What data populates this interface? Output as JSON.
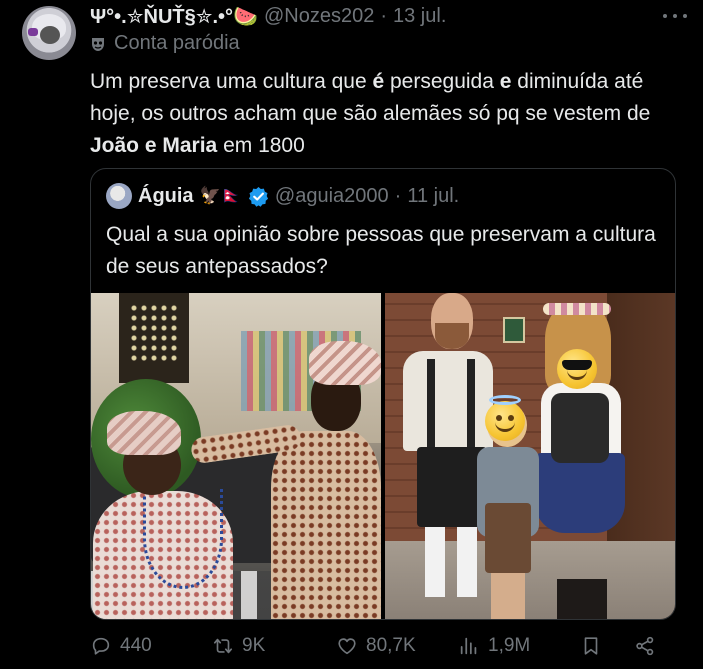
{
  "tweet": {
    "display_name": "Ψ°•.✮ŇUŤ§✮.•°🍉",
    "handle": "@Nozes202",
    "separator": "·",
    "date": "13 jul.",
    "parody_label": "Conta paródia",
    "text": {
      "p1": "Um preserva uma cultura que ",
      "b1": "é",
      "p2": " perseguida ",
      "b2": "e",
      "p3": " diminuída até hoje, os outros acham que são alemães só pq se vestem de ",
      "b3": "João e Maria",
      "p4": " em 1800"
    }
  },
  "quote": {
    "display_name": "Águia",
    "emoji": "🦅🇳🇵",
    "handle": "@aguia2000",
    "separator": "·",
    "date": "11 jul.",
    "text": "Qual a sua opinião sobre pessoas que preservam a cultura de seus antepassados?"
  },
  "actions": {
    "replies": "440",
    "reposts": "9K",
    "likes": "80,7K",
    "views": "1,9M"
  },
  "icons": [
    "more-icon",
    "mask-icon",
    "verified-icon",
    "reply-icon",
    "repost-icon",
    "like-icon",
    "views-icon",
    "bookmark-icon",
    "share-icon",
    "smiley-halo-icon",
    "smiley-sunglasses-icon"
  ],
  "colors": {
    "background": "#000000",
    "text": "#e7e9ea",
    "muted": "#71767b",
    "border": "#2f3336",
    "verified": "#1d9bf0"
  }
}
